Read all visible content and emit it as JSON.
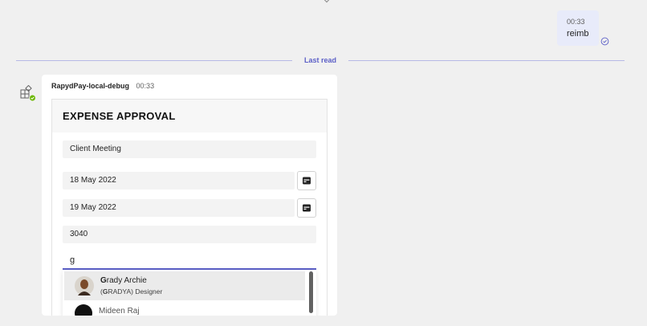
{
  "sent_message": {
    "time": "00:33",
    "text": "reimb"
  },
  "divider": {
    "label": "Last read"
  },
  "bot_message": {
    "sender": "RapydPay-local-debug",
    "time": "00:33"
  },
  "card": {
    "title": "EXPENSE APPROVAL",
    "purpose": "Client Meeting",
    "start_date": "18 May 2022",
    "end_date": "19 May 2022",
    "amount": "3040",
    "approver_search": "g",
    "suggestions": [
      {
        "name_highlight": "G",
        "name_rest": "rady Archie",
        "sub_prefix": "(",
        "sub_highlight": "G",
        "sub_rest": "RADYA) Designer"
      },
      {
        "name": "Mideen Raj"
      }
    ]
  },
  "colors": {
    "accent": "#5b5fc7",
    "bubble": "#e8ebfa",
    "background": "#f0f0f0",
    "presence": "#6bb700"
  },
  "icons": {
    "seen": "check-circle-icon",
    "bot": "app-grid-icon",
    "date": "calendar-icon"
  }
}
